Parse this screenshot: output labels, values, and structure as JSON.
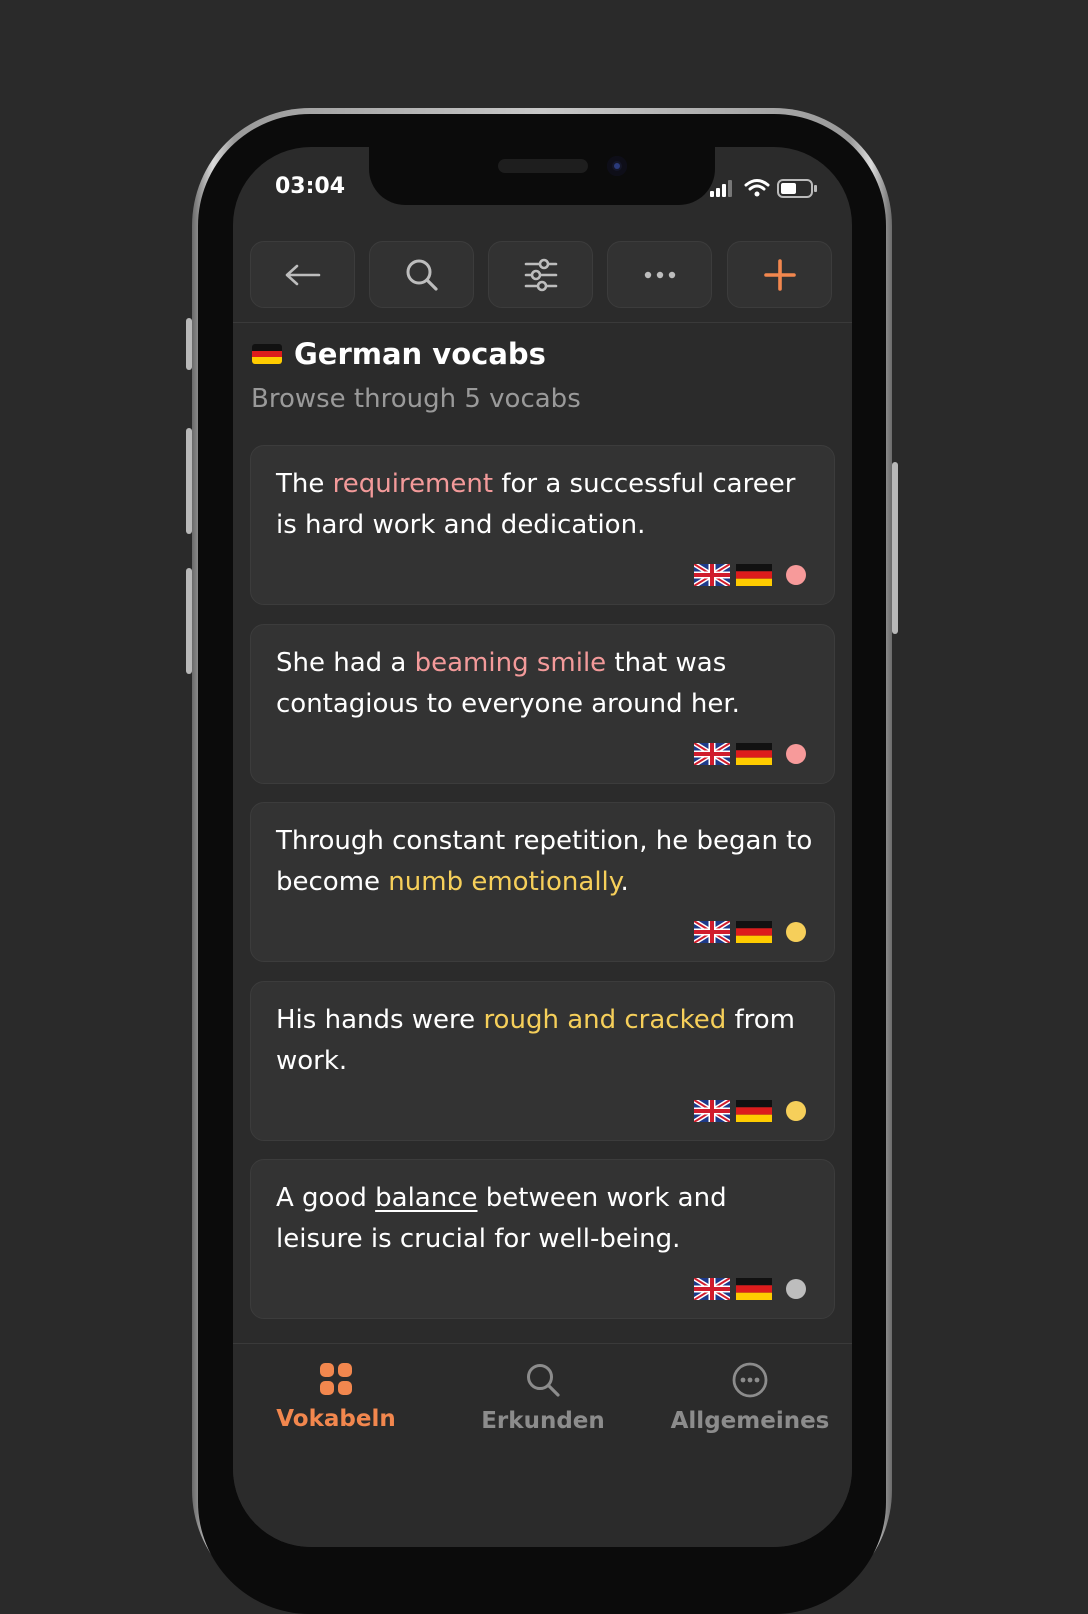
{
  "status_bar": {
    "time": "03:04"
  },
  "toolbar": {
    "back_icon": "arrow-left-icon",
    "search_icon": "search-icon",
    "filter_icon": "sliders-icon",
    "more_icon": "ellipsis-icon",
    "add_icon": "plus-icon"
  },
  "header": {
    "flag": "germany-flag-icon",
    "title": "German vocabs",
    "subtitle": "Browse through 5 vocabs"
  },
  "colors": {
    "accent": "#f2874e",
    "highlight_red": "#f39a9a",
    "highlight_yellow": "#f6cf5a",
    "dot_red": "#f79a9a",
    "dot_yellow": "#f6cf5a",
    "dot_grey": "#bdbdbd"
  },
  "vocabs": [
    {
      "before": "The ",
      "highlight": "requirement",
      "after": " for a successful career is hard work and dedication.",
      "style": "red",
      "status": "red"
    },
    {
      "before": "She had a ",
      "highlight": "beaming smile",
      "after": " that was contagious to everyone around her.",
      "style": "red",
      "status": "red"
    },
    {
      "before": "Through constant repetition, he began to become ",
      "highlight": "numb emotionally",
      "after": ".",
      "style": "yellow",
      "status": "yellow"
    },
    {
      "before": "His hands were ",
      "highlight": "rough and cracked",
      "after": " from work.",
      "style": "yellow",
      "status": "yellow"
    },
    {
      "before": "A good ",
      "highlight": "balance",
      "after": " between work and leisure is crucial for well-being.",
      "style": "underline",
      "status": "grey"
    }
  ],
  "tabbar": {
    "tabs": [
      {
        "label": "Vokabeln",
        "icon": "grid-icon",
        "active": true
      },
      {
        "label": "Erkunden",
        "icon": "search-icon",
        "active": false
      },
      {
        "label": "Allgemeines",
        "icon": "more-circle-icon",
        "active": false
      }
    ]
  }
}
